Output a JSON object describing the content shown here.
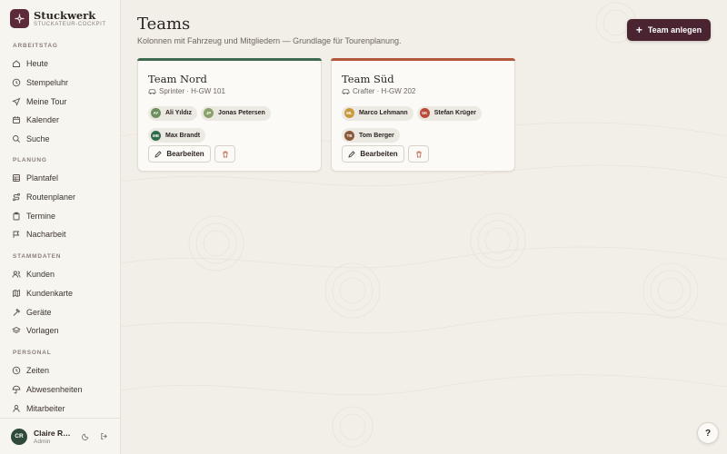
{
  "brand": {
    "name": "Stuckwerk",
    "subtitle": "STUCKATEUR-COCKPIT"
  },
  "sidebar": {
    "sections": [
      {
        "label": "ARBEITSTAG",
        "items": [
          {
            "label": "Heute",
            "icon": "home-icon"
          },
          {
            "label": "Stempeluhr",
            "icon": "clock-icon"
          },
          {
            "label": "Meine Tour",
            "icon": "navigation-icon"
          },
          {
            "label": "Kalender",
            "icon": "calendar-icon"
          },
          {
            "label": "Suche",
            "icon": "search-icon"
          }
        ]
      },
      {
        "label": "PLANUNG",
        "items": [
          {
            "label": "Plantafel",
            "icon": "grid-icon"
          },
          {
            "label": "Routenplaner",
            "icon": "route-icon"
          },
          {
            "label": "Termine",
            "icon": "clipboard-icon"
          },
          {
            "label": "Nacharbeit",
            "icon": "flag-icon"
          }
        ]
      },
      {
        "label": "STAMMDATEN",
        "items": [
          {
            "label": "Kunden",
            "icon": "users-icon"
          },
          {
            "label": "Kundenkarte",
            "icon": "map-icon"
          },
          {
            "label": "Geräte",
            "icon": "hammer-icon"
          },
          {
            "label": "Vorlagen",
            "icon": "layers-icon"
          }
        ]
      },
      {
        "label": "PERSONAL",
        "items": [
          {
            "label": "Zeiten",
            "icon": "clock-icon"
          },
          {
            "label": "Abwesenheiten",
            "icon": "umbrella-icon"
          },
          {
            "label": "Mitarbeiter",
            "icon": "user-icon"
          }
        ]
      }
    ]
  },
  "user": {
    "initials": "CR",
    "name": "Claire Ro...",
    "role": "Admin"
  },
  "page": {
    "title": "Teams",
    "subtitle": "Kolonnen mit Fahrzeug und Mitgliedern — Grundlage für Tourenplanung.",
    "add_button": "Team anlegen"
  },
  "teams": [
    {
      "name": "Team Nord",
      "vehicle": "Sprinter · H-GW 101",
      "accent": "#3d6b4f",
      "members": [
        {
          "initials": "AY",
          "name": "Ali Yıldız",
          "color": "#6b8f5e"
        },
        {
          "initials": "JP",
          "name": "Jonas Petersen",
          "color": "#8aa16a"
        },
        {
          "initials": "MB",
          "name": "Max Brandt",
          "color": "#2f6a4a"
        }
      ]
    },
    {
      "name": "Team Süd",
      "vehicle": "Crafter · H-GW 202",
      "accent": "#b3583d",
      "members": [
        {
          "initials": "ML",
          "name": "Marco Lehmann",
          "color": "#c99a3c"
        },
        {
          "initials": "SK",
          "name": "Stefan Krüger",
          "color": "#b94a3a"
        },
        {
          "initials": "TB",
          "name": "Tom Berger",
          "color": "#8a5a3a"
        }
      ]
    }
  ],
  "actions": {
    "edit_label": "Bearbeiten"
  },
  "help": {
    "label": "?"
  },
  "colors": {
    "brand": "#4a2430",
    "sidebar_bg": "#f7f5f0",
    "page_bg": "#f2efe8"
  }
}
